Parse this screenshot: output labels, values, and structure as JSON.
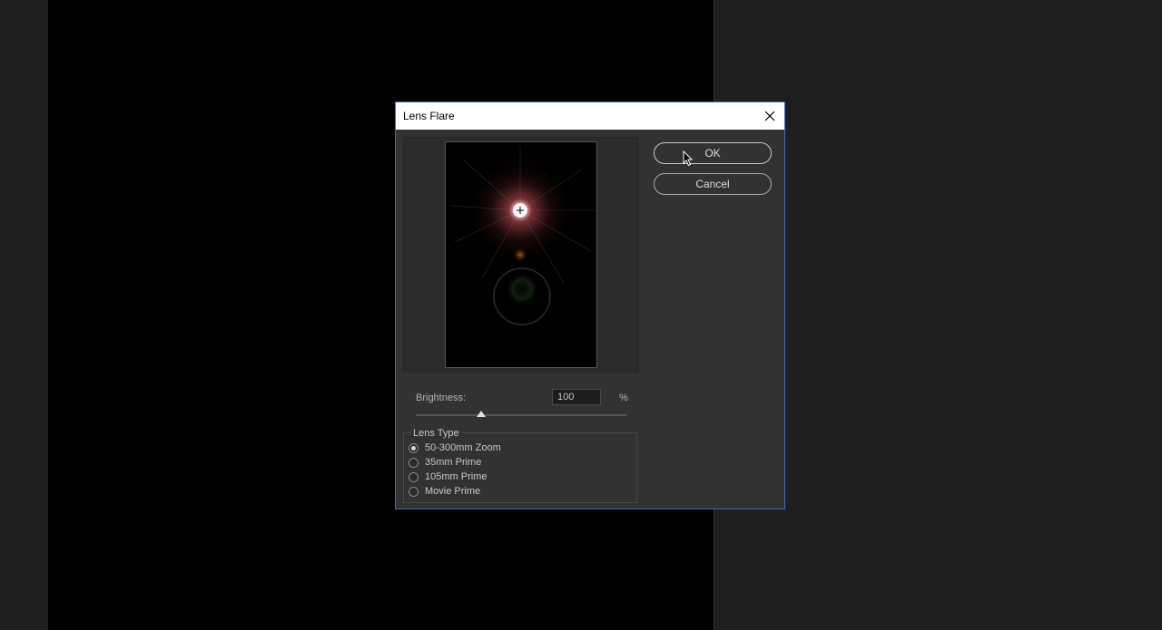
{
  "dialog": {
    "title": "Lens Flare",
    "ok_label": "OK",
    "cancel_label": "Cancel",
    "brightness": {
      "label": "Brightness:",
      "value": "100",
      "unit": "%",
      "slider_fraction": 0.31
    },
    "lens_type": {
      "legend": "Lens Type",
      "options": [
        {
          "label": "50-300mm Zoom",
          "selected": true
        },
        {
          "label": "35mm Prime",
          "selected": false
        },
        {
          "label": "105mm Prime",
          "selected": false
        },
        {
          "label": "Movie Prime",
          "selected": false
        }
      ]
    }
  },
  "colors": {
    "accent_border": "#3c6fbf",
    "dialog_bg": "#323232",
    "flare_core": "#ffd0d0"
  },
  "icons": {
    "close": "close-icon",
    "cursor": "mouse-pointer-icon",
    "crosshair": "crosshair-icon"
  }
}
